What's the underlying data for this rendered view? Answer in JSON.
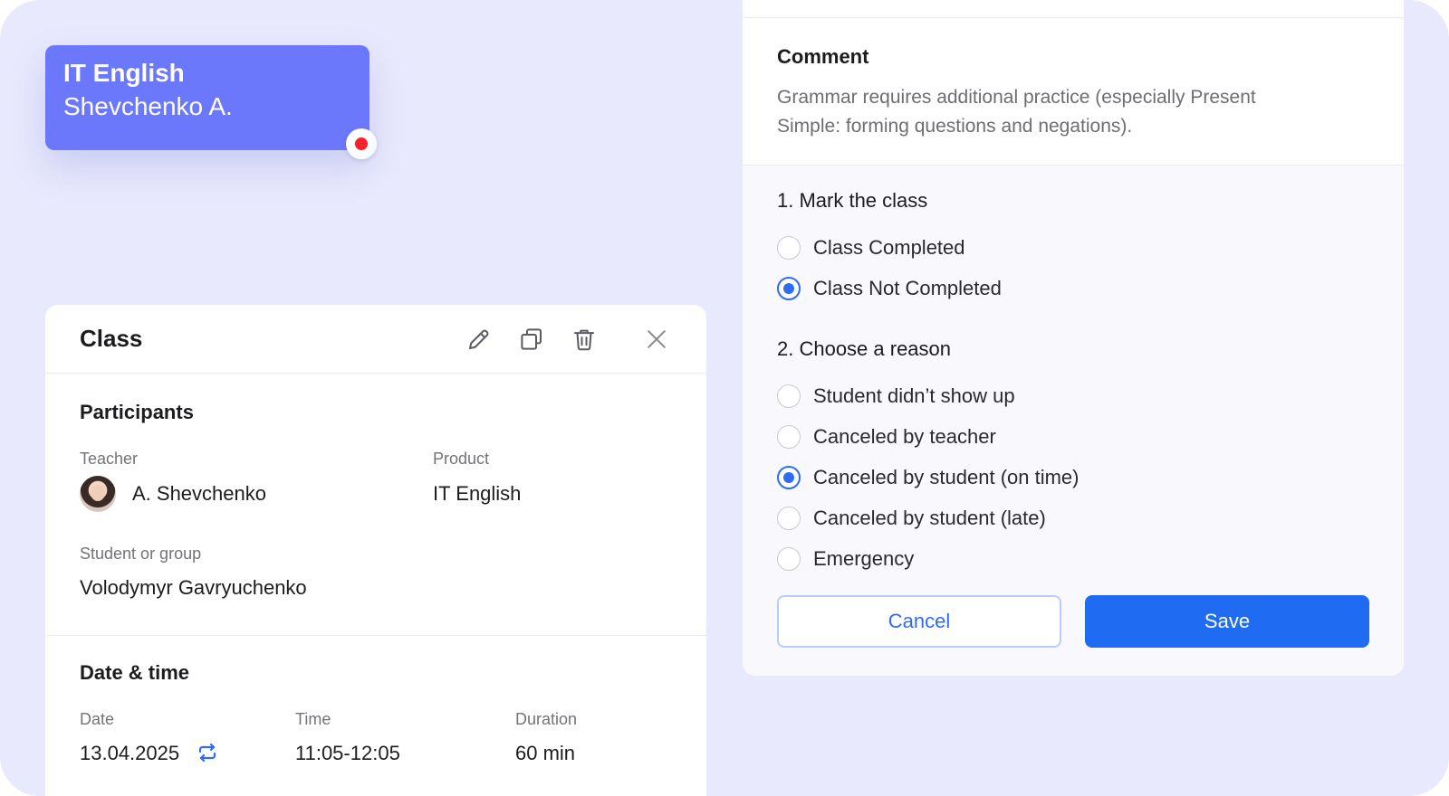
{
  "event_chip": {
    "title": "IT English",
    "teacher": "Shevchenko A."
  },
  "class_card": {
    "title": "Class",
    "actions": [
      "pencil-icon",
      "copy-icon",
      "trash-icon",
      "close-icon"
    ],
    "participants": {
      "title": "Participants",
      "teacher_label": "Teacher",
      "teacher_value": "A. Shevchenko",
      "product_label": "Product",
      "product_value": "IT English",
      "student_label": "Student or group",
      "student_value": "Volodymyr Gavryuchenko"
    },
    "datetime": {
      "title": "Date & time",
      "date_label": "Date",
      "date_value": "13.04.2025",
      "time_label": "Time",
      "time_value": "11:05-12:05",
      "duration_label": "Duration",
      "duration_value": "60 min"
    }
  },
  "right_panel": {
    "comment_title": "Comment",
    "comment_text": "Grammar requires additional practice (especially Present Simple: forming questions and negations).",
    "mark": {
      "title": "1. Mark the class",
      "options": [
        {
          "label": "Class Completed",
          "checked": false
        },
        {
          "label": "Class Not Completed",
          "checked": true
        }
      ]
    },
    "reason": {
      "title": "2. Choose a reason",
      "options": [
        {
          "label": "Student didn’t show up",
          "checked": false
        },
        {
          "label": "Canceled by teacher",
          "checked": false
        },
        {
          "label": "Canceled by student (on time)",
          "checked": true
        },
        {
          "label": "Canceled by student (late)",
          "checked": false
        },
        {
          "label": "Emergency",
          "checked": false
        }
      ]
    },
    "buttons": {
      "cancel": "Cancel",
      "save": "Save"
    }
  },
  "colors": {
    "background": "#e8e9fc",
    "chip": "#6b78fb",
    "accent": "#2f6cf6",
    "status_dot": "#f5222d"
  }
}
